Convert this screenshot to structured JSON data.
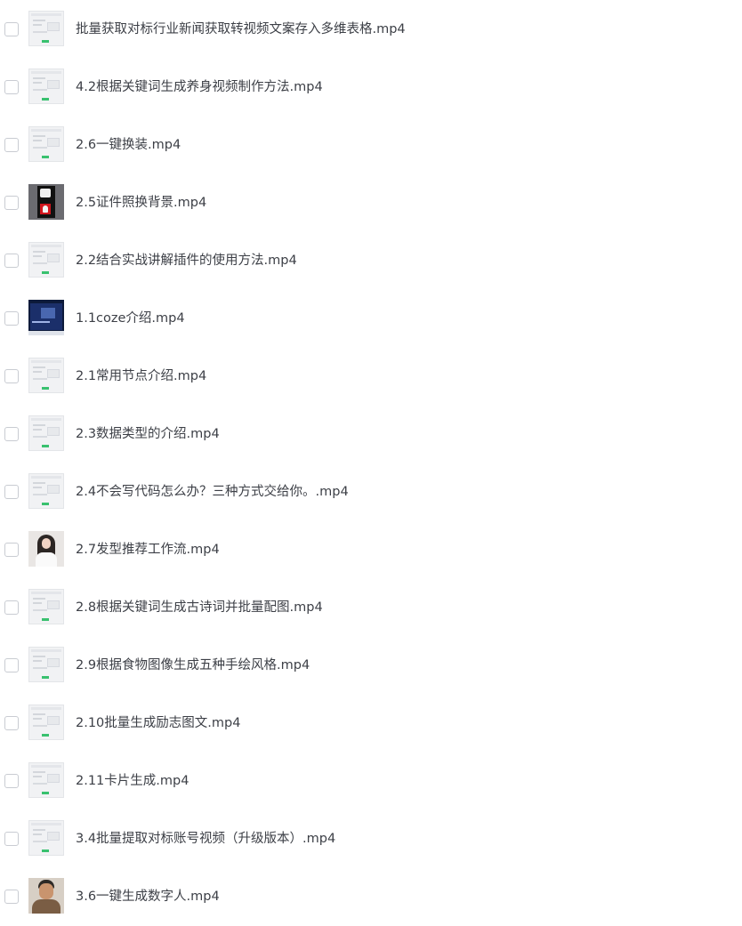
{
  "files": [
    {
      "name": "批量获取对标行业新闻获取转视频文案存入多维表格.mp4",
      "thumb_icon": "workflow-screenshot-thumbnail"
    },
    {
      "name": "4.2根据关键词生成养身视频制作方法.mp4",
      "thumb_icon": "workflow-screenshot-thumbnail"
    },
    {
      "name": "2.6一键换装.mp4",
      "thumb_icon": "workflow-screenshot-thumbnail"
    },
    {
      "name": "2.5证件照换背景.mp4",
      "thumb_icon": "id-photo-thumbnail"
    },
    {
      "name": "2.2结合实战讲解插件的使用方法.mp4",
      "thumb_icon": "workflow-screenshot-thumbnail"
    },
    {
      "name": "1.1coze介绍.mp4",
      "thumb_icon": "presentation-screen-thumbnail"
    },
    {
      "name": "2.1常用节点介绍.mp4",
      "thumb_icon": "workflow-screenshot-thumbnail"
    },
    {
      "name": "2.3数据类型的介绍.mp4",
      "thumb_icon": "workflow-screenshot-thumbnail"
    },
    {
      "name": "2.4不会写代码怎么办？三种方式交给你。.mp4",
      "thumb_icon": "workflow-screenshot-thumbnail"
    },
    {
      "name": "2.7发型推荐工作流.mp4",
      "thumb_icon": "portrait-photo-thumbnail"
    },
    {
      "name": "2.8根据关键词生成古诗词并批量配图.mp4",
      "thumb_icon": "workflow-screenshot-thumbnail"
    },
    {
      "name": "2.9根据食物图像生成五种手绘风格.mp4",
      "thumb_icon": "workflow-screenshot-thumbnail"
    },
    {
      "name": "2.10批量生成励志图文.mp4",
      "thumb_icon": "workflow-screenshot-thumbnail"
    },
    {
      "name": "2.11卡片生成.mp4",
      "thumb_icon": "workflow-screenshot-thumbnail"
    },
    {
      "name": "3.4批量提取对标账号视频（升级版本）.mp4",
      "thumb_icon": "workflow-screenshot-thumbnail"
    },
    {
      "name": "3.6一键生成数字人.mp4",
      "thumb_icon": "person-photo-thumbnail"
    }
  ],
  "colors": {
    "text": "#3c3f46",
    "checkbox_border": "#c9ccd2",
    "accent_green": "#39c16f"
  }
}
